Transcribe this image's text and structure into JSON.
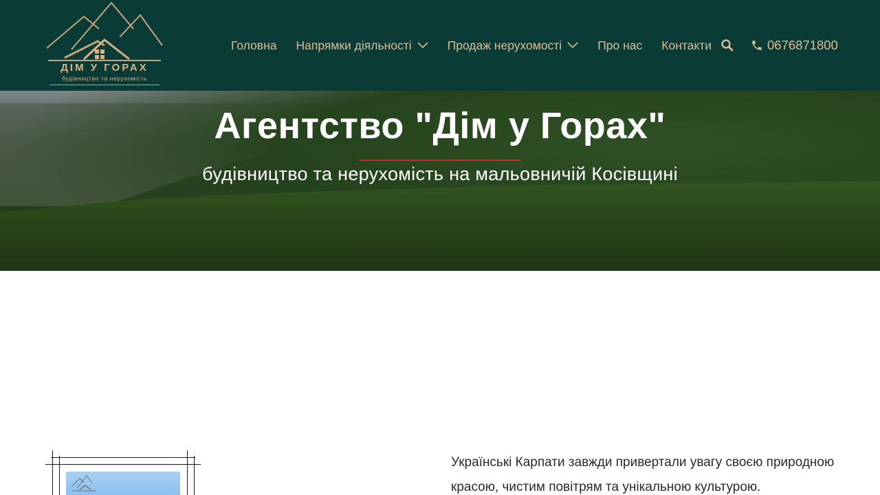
{
  "header": {
    "logo": {
      "title": "ДІМ У ГОРАХ",
      "subtitle": "будівництво та нерухомість",
      "accent_color": "#d8b483"
    },
    "nav": [
      {
        "label": "Головна",
        "has_dropdown": false
      },
      {
        "label": "Напрямки діяльності",
        "has_dropdown": true
      },
      {
        "label": "Продаж нерухомості",
        "has_dropdown": true
      },
      {
        "label": "Про нас",
        "has_dropdown": false
      },
      {
        "label": "Контакти",
        "has_dropdown": false
      }
    ],
    "search_icon": "search-icon",
    "phone": {
      "icon": "phone-icon",
      "number": "0676871800"
    },
    "background_color": "#0b3b36",
    "text_color": "#dcbe93"
  },
  "hero": {
    "title": "Агентство \"Дім у Горах\"",
    "subtitle": "будівництво та нерухомість на мальовничій Косівщині",
    "divider_color": "#b8372d"
  },
  "content": {
    "intro_text": "Українські Карпати завжди привертали увагу своєю природною красою, чистим повітрям та унікальною культурою."
  }
}
